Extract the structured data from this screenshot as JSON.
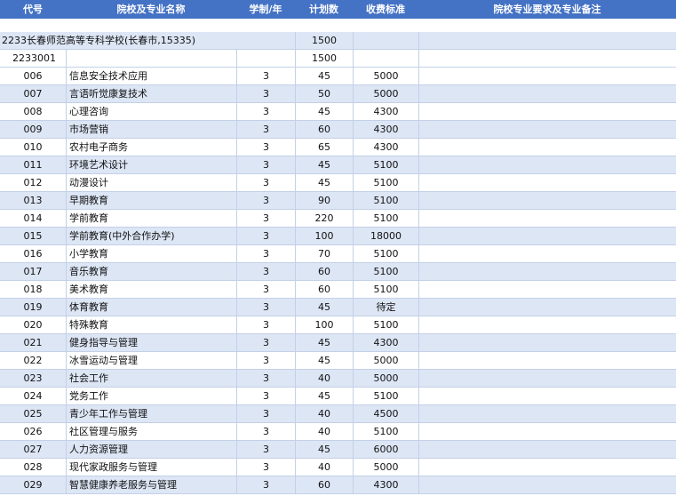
{
  "header": {
    "code": "代号",
    "name": "院校及专业名称",
    "years": "学制/年",
    "plan": "计划数",
    "fee": "收费标准",
    "notes": "院校专业要求及专业备注"
  },
  "school": {
    "name": "2233长春师范高等专科学校(长春市,15335)",
    "plan": "1500"
  },
  "group": {
    "code": "2233001",
    "plan": "1500"
  },
  "majors": [
    {
      "code": "006",
      "name": "信息安全技术应用",
      "years": "3",
      "plan": "45",
      "fee": "5000"
    },
    {
      "code": "007",
      "name": "言语听觉康复技术",
      "years": "3",
      "plan": "50",
      "fee": "5000"
    },
    {
      "code": "008",
      "name": "心理咨询",
      "years": "3",
      "plan": "45",
      "fee": "4300"
    },
    {
      "code": "009",
      "name": "市场营销",
      "years": "3",
      "plan": "60",
      "fee": "4300"
    },
    {
      "code": "010",
      "name": "农村电子商务",
      "years": "3",
      "plan": "65",
      "fee": "4300"
    },
    {
      "code": "011",
      "name": "环境艺术设计",
      "years": "3",
      "plan": "45",
      "fee": "5100"
    },
    {
      "code": "012",
      "name": "动漫设计",
      "years": "3",
      "plan": "45",
      "fee": "5100"
    },
    {
      "code": "013",
      "name": "早期教育",
      "years": "3",
      "plan": "90",
      "fee": "5100"
    },
    {
      "code": "014",
      "name": "学前教育",
      "years": "3",
      "plan": "220",
      "fee": "5100"
    },
    {
      "code": "015",
      "name": "学前教育(中外合作办学)",
      "years": "3",
      "plan": "100",
      "fee": "18000"
    },
    {
      "code": "016",
      "name": "小学教育",
      "years": "3",
      "plan": "70",
      "fee": "5100"
    },
    {
      "code": "017",
      "name": "音乐教育",
      "years": "3",
      "plan": "60",
      "fee": "5100"
    },
    {
      "code": "018",
      "name": "美术教育",
      "years": "3",
      "plan": "60",
      "fee": "5100"
    },
    {
      "code": "019",
      "name": "体育教育",
      "years": "3",
      "plan": "45",
      "fee": "待定"
    },
    {
      "code": "020",
      "name": "特殊教育",
      "years": "3",
      "plan": "100",
      "fee": "5100"
    },
    {
      "code": "021",
      "name": "健身指导与管理",
      "years": "3",
      "plan": "45",
      "fee": "4300"
    },
    {
      "code": "022",
      "name": "冰雪运动与管理",
      "years": "3",
      "plan": "45",
      "fee": "5000"
    },
    {
      "code": "023",
      "name": "社会工作",
      "years": "3",
      "plan": "40",
      "fee": "5000"
    },
    {
      "code": "024",
      "name": "党务工作",
      "years": "3",
      "plan": "45",
      "fee": "5100"
    },
    {
      "code": "025",
      "name": "青少年工作与管理",
      "years": "3",
      "plan": "40",
      "fee": "4500"
    },
    {
      "code": "026",
      "name": "社区管理与服务",
      "years": "3",
      "plan": "40",
      "fee": "5100"
    },
    {
      "code": "027",
      "name": "人力资源管理",
      "years": "3",
      "plan": "45",
      "fee": "6000"
    },
    {
      "code": "028",
      "name": "现代家政服务与管理",
      "years": "3",
      "plan": "40",
      "fee": "5000"
    },
    {
      "code": "029",
      "name": "智慧健康养老服务与管理",
      "years": "3",
      "plan": "60",
      "fee": "4300"
    }
  ]
}
